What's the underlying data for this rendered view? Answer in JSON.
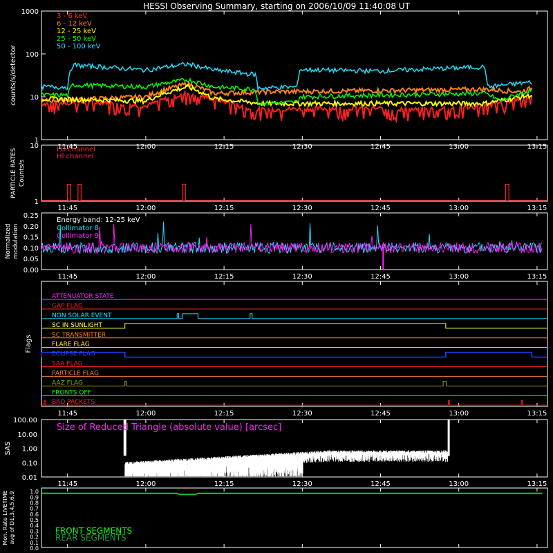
{
  "title": "HESSI Observing Summary, starting on 2006/10/09 11:40:08 UT",
  "time_ticks": [
    "11:45",
    "12:00",
    "12:15",
    "12:30",
    "12:45",
    "13:00",
    "13:15"
  ],
  "colors": {
    "background": "#000000",
    "axes": "#ffffff",
    "red": "#ff2020",
    "orange": "#ff8020",
    "yellow": "#ffff00",
    "green": "#00ff00",
    "cyan": "#20e0ff",
    "magenta": "#ff20ff",
    "blue": "#2040ff",
    "olive": "#a0a020"
  },
  "chart_data": [
    {
      "type": "line",
      "panel": "count-rates",
      "ylabel": "counts/s/detector",
      "yscale": "log",
      "ylim": [
        1,
        1000
      ],
      "y_ticks": [
        "1",
        "10",
        "100",
        "1000"
      ],
      "series": [
        {
          "name": "3 - 6 keV",
          "color": "#ff2020",
          "points": [
            [
              0,
              7
            ],
            [
              12,
              7.5
            ],
            [
              20,
              6
            ],
            [
              28,
              12
            ],
            [
              33,
              9
            ],
            [
              40,
              5
            ],
            [
              60,
              5.5
            ],
            [
              72,
              5
            ],
            [
              85,
              6
            ],
            [
              94,
              10
            ]
          ]
        },
        {
          "name": "6 - 12 keV",
          "color": "#ff8020",
          "points": [
            [
              0,
              8
            ],
            [
              20,
              10
            ],
            [
              28,
              20
            ],
            [
              33,
              12
            ],
            [
              42,
              13
            ],
            [
              65,
              14
            ],
            [
              85,
              15
            ],
            [
              92,
              13
            ],
            [
              94,
              16
            ]
          ]
        },
        {
          "name": "12 - 25 keV",
          "color": "#ffff00",
          "points": [
            [
              0,
              9
            ],
            [
              20,
              8
            ],
            [
              28,
              17
            ],
            [
              33,
              9
            ],
            [
              42,
              7
            ],
            [
              85,
              7
            ],
            [
              90,
              9
            ],
            [
              94,
              11
            ]
          ]
        },
        {
          "name": "25 - 50 keV",
          "color": "#00ff00",
          "points": [
            [
              0,
              11
            ],
            [
              5,
              11
            ],
            [
              6,
              19
            ],
            [
              20,
              17
            ],
            [
              28,
              25
            ],
            [
              33,
              17
            ],
            [
              41,
              15
            ],
            [
              41.5,
              7
            ],
            [
              49,
              7.5
            ],
            [
              49.5,
              10
            ],
            [
              65,
              11
            ],
            [
              85,
              12
            ],
            [
              88,
              8
            ],
            [
              94,
              14
            ]
          ]
        },
        {
          "name": "50 - 100 keV",
          "color": "#20e0ff",
          "points": [
            [
              0,
              17
            ],
            [
              5,
              17
            ],
            [
              6,
              55
            ],
            [
              20,
              42
            ],
            [
              28,
              58
            ],
            [
              33,
              42
            ],
            [
              41,
              33
            ],
            [
              41.5,
              16
            ],
            [
              49,
              17
            ],
            [
              49.5,
              43
            ],
            [
              65,
              40
            ],
            [
              85,
              50
            ],
            [
              85.5,
              17
            ],
            [
              94,
              22
            ]
          ]
        }
      ]
    },
    {
      "type": "line",
      "panel": "particle-rates",
      "ylabel": "PARTICLE RATES Counts/s",
      "yscale": "log",
      "ylim": [
        1,
        10
      ],
      "y_ticks": [
        "1",
        "10"
      ],
      "series": [
        {
          "name": "LO channel",
          "color": "#ff2020",
          "spikes": [
            5,
            7,
            27,
            89
          ]
        },
        {
          "name": "HI channel",
          "color": "#ff2060",
          "spikes": []
        }
      ]
    },
    {
      "type": "line",
      "panel": "modulation",
      "ylabel": "Normalized modulation",
      "ylim": [
        0,
        0.25
      ],
      "y_ticks": [
        "0.25",
        "0.20",
        "0.15",
        "0.10",
        "0.05",
        "0.00"
      ],
      "annotation": "Energy band: 12-25 keV",
      "series": [
        {
          "name": "Collimator 8",
          "color": "#20e0ff",
          "baseline": 0.1
        },
        {
          "name": "Collimator 9",
          "color": "#ff20ff",
          "baseline": 0.1
        }
      ]
    },
    {
      "type": "line",
      "panel": "flags",
      "ylabel": "Flags",
      "flags": [
        {
          "name": "ATTENUATOR STATE",
          "color": "#ff20ff",
          "steps": []
        },
        {
          "name": "GAP FLAG",
          "color": "#ff2020",
          "steps": []
        },
        {
          "name": "NON SOLAR EVENT",
          "color": "#20e0ff",
          "steps": [
            [
              26,
              26.3
            ],
            [
              27,
              30
            ],
            [
              40,
              40.4
            ]
          ]
        },
        {
          "name": "SC IN SUNLIGHT",
          "color": "#ffff40",
          "steps": [
            [
              16,
              77.5
            ]
          ]
        },
        {
          "name": "SC TRANSMITTER",
          "color": "#ff8020",
          "steps": []
        },
        {
          "name": "FLARE FLAG",
          "color": "#ffff00",
          "steps": []
        },
        {
          "name": "ECLIPSE FLAG",
          "color": "#2040ff",
          "steps": [
            [
              0,
              16
            ],
            [
              77.5,
              94
            ]
          ]
        },
        {
          "name": "SAA FLAG",
          "color": "#ff2020",
          "steps": []
        },
        {
          "name": "PARTICLE FLAG",
          "color": "#ff8040",
          "steps": []
        },
        {
          "name": "AAZ FLAG",
          "color": "#a0a020",
          "steps": [
            [
              16,
              16.3
            ],
            [
              77,
              77.6
            ]
          ]
        },
        {
          "name": "FRONTS OFF",
          "color": "#00ff00",
          "steps": []
        },
        {
          "name": "BAD PACKETS",
          "color": "#ff2020",
          "steps": [
            [
              0.5,
              0.7
            ],
            [
              78,
              78.2
            ],
            [
              92,
              92.2
            ]
          ]
        }
      ]
    },
    {
      "type": "line",
      "panel": "sas",
      "ylabel": "SAS",
      "yscale": "log",
      "ylim": [
        0.01,
        100
      ],
      "y_ticks": [
        "100.00",
        "10.00",
        "1.00",
        "0.10",
        "0.01"
      ],
      "annotation": "Size of Reduced Triangle (absolute value) [arcsec]",
      "series": [
        {
          "name": "Reduced triangle",
          "color": "#ffffff",
          "start": 16,
          "end": 78,
          "level_start": 0.07,
          "level_end": 0.45
        }
      ]
    },
    {
      "type": "line",
      "panel": "livetime",
      "ylabel": "Mon. Rate LIVETIME avg of D1,3,4,5,6,9",
      "ylim": [
        0,
        1
      ],
      "y_ticks": [
        "1.0",
        "0.9",
        "0.8",
        "0.7",
        "0.6",
        "0.5",
        "0.4",
        "0.3",
        "0.2",
        "0.1",
        "0.0"
      ],
      "series": [
        {
          "name": "FRONT SEGMENTS",
          "color": "#00ff00",
          "value": 0.96
        },
        {
          "name": "REAR SEGMENTS",
          "color": "#20a040",
          "value": 0.95
        }
      ]
    }
  ]
}
